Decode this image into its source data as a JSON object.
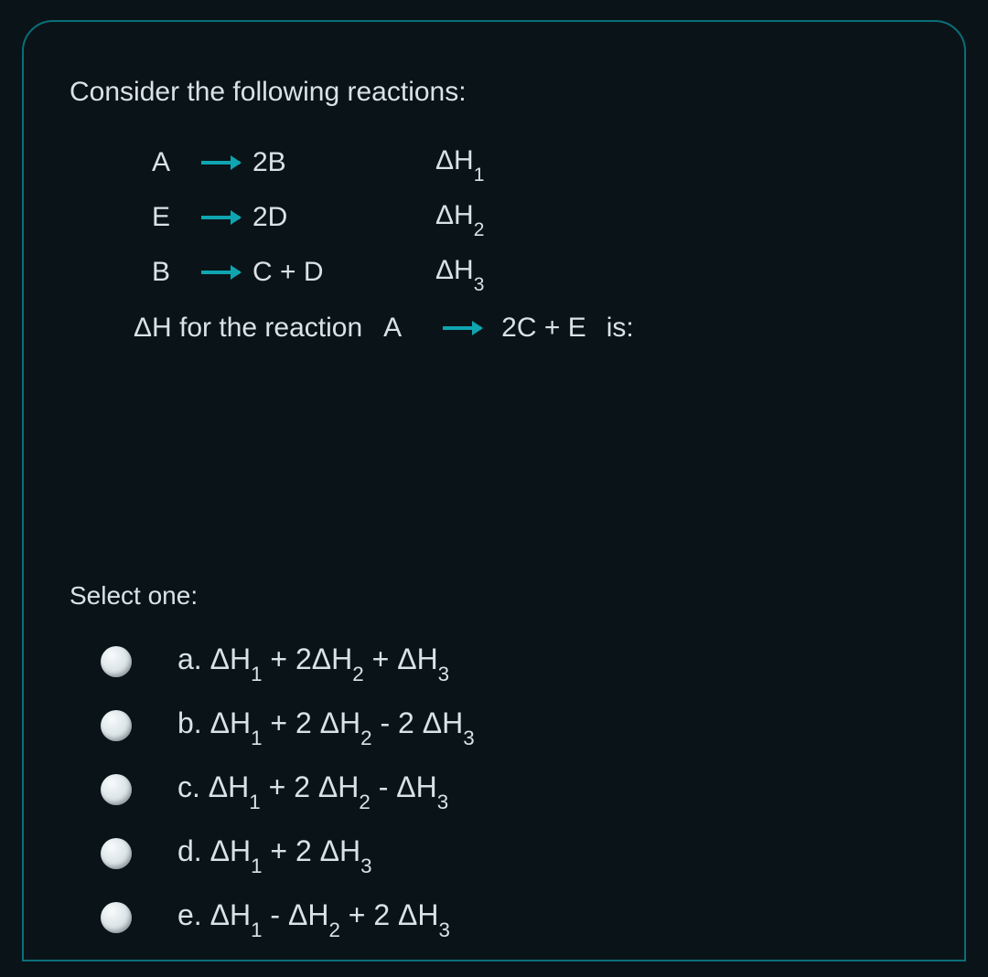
{
  "prompt": "Consider the following reactions:",
  "reactions": [
    {
      "lhs": "A",
      "rhs": "2B",
      "dh_base": "ΔH",
      "dh_sub": "1"
    },
    {
      "lhs": "E",
      "rhs": "2D",
      "dh_base": "ΔH",
      "dh_sub": "2"
    },
    {
      "lhs": "B",
      "rhs": "C + D",
      "dh_base": "ΔH",
      "dh_sub": "3"
    }
  ],
  "target": {
    "prefix": "ΔH for the reaction",
    "lhs": "A",
    "rhs": "2C + E",
    "suffix": "is:"
  },
  "select_label": "Select one:",
  "options": [
    {
      "letter": "a.",
      "parts": [
        {
          "t": " ΔH",
          "sub": "1"
        },
        {
          "t": " + 2ΔH",
          "sub": "2"
        },
        {
          "t": " + ΔH",
          "sub": "3"
        }
      ]
    },
    {
      "letter": "b.",
      "parts": [
        {
          "t": " ΔH",
          "sub": "1"
        },
        {
          "t": " + 2 ΔH",
          "sub": "2"
        },
        {
          "t": " - 2 ΔH",
          "sub": "3"
        }
      ]
    },
    {
      "letter": "c.",
      "parts": [
        {
          "t": " ΔH",
          "sub": "1"
        },
        {
          "t": " + 2 ΔH",
          "sub": "2"
        },
        {
          "t": " - ΔH",
          "sub": "3"
        }
      ]
    },
    {
      "letter": "d.",
      "parts": [
        {
          "t": " ΔH",
          "sub": "1"
        },
        {
          "t": " + 2 ΔH",
          "sub": "3"
        }
      ]
    },
    {
      "letter": "e.",
      "parts": [
        {
          "t": "  ΔH",
          "sub": "1"
        },
        {
          "t": " - ΔH",
          "sub": "2"
        },
        {
          "t": " + 2 ΔH",
          "sub": "3"
        }
      ]
    }
  ]
}
